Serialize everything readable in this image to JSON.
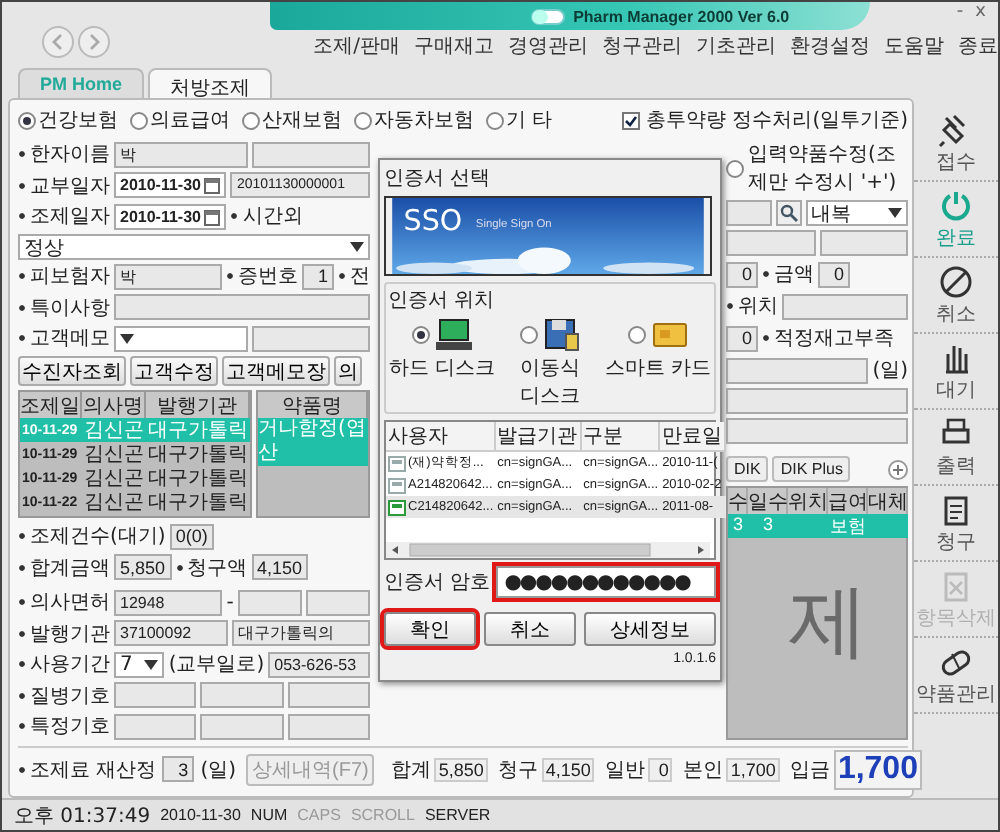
{
  "window": {
    "title": "Pharm Manager 2000 Ver 6.0",
    "controls": [
      "-",
      "x"
    ]
  },
  "menu": [
    "조제/판매",
    "구매재고",
    "경영관리",
    "청구관리",
    "기초관리",
    "환경설정",
    "도움말",
    "종료"
  ],
  "tabs": [
    {
      "label": "PM Home",
      "selected": false
    },
    {
      "label": "처방조제",
      "selected": true
    }
  ],
  "insurance_types": [
    {
      "label": "건강보험",
      "selected": true
    },
    {
      "label": "의료급여",
      "selected": false
    },
    {
      "label": "산재보험",
      "selected": false
    },
    {
      "label": "자동차보험",
      "selected": false
    },
    {
      "label": "기 타",
      "selected": false
    }
  ],
  "rounding_option": {
    "label": "총투약량 정수처리(일투기준)",
    "checked": true
  },
  "patient_form": [
    [
      {
        "kind": "label",
        "text": "한자이름"
      },
      {
        "kind": "field",
        "text": "박"
      },
      {
        "kind": "field"
      }
    ],
    [
      {
        "kind": "label",
        "text": "교부일자"
      },
      {
        "kind": "date",
        "text": "2010-11-30"
      },
      {
        "kind": "field",
        "text": "20101130000001"
      }
    ],
    [
      {
        "kind": "label",
        "text": "조제일자"
      },
      {
        "kind": "date",
        "text": "2010-11-30"
      },
      {
        "kind": "label",
        "text": "시간외"
      },
      {
        "kind": "select",
        "text": "정상"
      }
    ],
    [
      {
        "kind": "label",
        "text": "피보험자"
      },
      {
        "kind": "field",
        "text": "박"
      },
      {
        "kind": "label",
        "text": "증번호"
      },
      {
        "kind": "num",
        "text": "1"
      },
      {
        "kind": "label",
        "text": "전"
      }
    ],
    [
      {
        "kind": "label",
        "text": "특이사항"
      },
      {
        "kind": "field"
      }
    ],
    [
      {
        "kind": "label",
        "text": "고객메모"
      },
      {
        "kind": "select"
      },
      {
        "kind": "field"
      }
    ]
  ],
  "patient_buttons": [
    "수진자조회",
    "고객수정",
    "고객메모장",
    "의"
  ],
  "history": {
    "columns": [
      "조제일",
      "의사명",
      "발행기관"
    ],
    "rows": [
      {
        "cells": [
          "10-11-29",
          "김신곤",
          "대구가톨릭"
        ],
        "selected": true
      },
      {
        "cells": [
          "10-11-29",
          "김신곤",
          "대구가톨릭"
        ],
        "selected": false
      },
      {
        "cells": [
          "10-11-29",
          "김신곤",
          "대구가톨릭"
        ],
        "selected": false
      },
      {
        "cells": [
          "10-11-22",
          "김신곤",
          "대구가톨릭"
        ],
        "selected": false
      }
    ]
  },
  "drug_names": {
    "column": "약품명",
    "rows": [
      {
        "name": "거나함정(엽산",
        "selected": true
      }
    ]
  },
  "summary_form": [
    [
      {
        "kind": "label",
        "text": "조제건수(대기)"
      },
      {
        "kind": "num",
        "text": "0(0)"
      }
    ],
    [
      {
        "kind": "label",
        "text": "합계금액"
      },
      {
        "kind": "num",
        "text": "5,850"
      },
      {
        "kind": "label",
        "text": "청구액"
      },
      {
        "kind": "num",
        "text": "4,150"
      }
    ]
  ],
  "prescriber_form": [
    [
      {
        "kind": "label",
        "text": "의사면허"
      },
      {
        "kind": "field",
        "text": "12948"
      },
      {
        "kind": "note",
        "text": "-"
      },
      {
        "kind": "field"
      },
      {
        "kind": "field"
      }
    ],
    [
      {
        "kind": "label",
        "text": "발행기관"
      },
      {
        "kind": "field",
        "text": "37100092"
      },
      {
        "kind": "field",
        "text": "대구가톨릭의"
      }
    ],
    [
      {
        "kind": "label",
        "text": "사용기간"
      },
      {
        "kind": "select",
        "text": "7"
      },
      {
        "kind": "note",
        "text": "(교부일로)"
      },
      {
        "kind": "field",
        "text": "053-626-53"
      }
    ],
    [
      {
        "kind": "label",
        "text": "질병기호"
      },
      {
        "kind": "field"
      },
      {
        "kind": "field"
      },
      {
        "kind": "field"
      }
    ],
    [
      {
        "kind": "label",
        "text": "특정기호"
      },
      {
        "kind": "field"
      },
      {
        "kind": "field"
      },
      {
        "kind": "field"
      }
    ]
  ],
  "drug_entry": {
    "mode": {
      "label": "입력약품수정(조제만 수정시 '+')",
      "selected": false
    },
    "form": [
      [
        {
          "kind": "field"
        },
        {
          "kind": "search"
        },
        {
          "kind": "select",
          "text": "내복"
        }
      ],
      [
        {
          "kind": "field"
        },
        {
          "kind": "field"
        }
      ],
      [
        {
          "kind": "num",
          "text": "0"
        },
        {
          "kind": "label",
          "text": "금액"
        },
        {
          "kind": "num",
          "text": "0"
        }
      ],
      [
        {
          "kind": "label",
          "text": "위치"
        },
        {
          "kind": "field"
        }
      ],
      [
        {
          "kind": "num",
          "text": "0"
        },
        {
          "kind": "label",
          "text": "적정재고부족"
        }
      ],
      [
        {
          "kind": "field"
        },
        {
          "kind": "note",
          "text": "(일)"
        }
      ],
      [
        {
          "kind": "field"
        }
      ],
      [
        {
          "kind": "field"
        }
      ]
    ]
  },
  "drug_tabs": [
    {
      "label": "DIK",
      "selected": false
    },
    {
      "label": "DIK Plus",
      "selected": false
    }
  ],
  "drug_table": {
    "columns": [
      "수",
      "일수",
      "위치",
      "급여",
      "대체"
    ],
    "rows": [
      {
        "cells": [
          "3",
          "3",
          null,
          "보험",
          null
        ],
        "selected": true
      }
    ],
    "background_text": "제"
  },
  "recalc": {
    "label": "조제료 재산정",
    "value": "3",
    "unit": "(일)",
    "button": "상세내역(F7)",
    "button_disabled": true
  },
  "totals": [
    {
      "label": "합계",
      "value": "5,850",
      "kind": "normal"
    },
    {
      "label": "청구",
      "value": "4,150",
      "kind": "normal"
    },
    {
      "label": "일반",
      "value": "0",
      "kind": "normal"
    },
    {
      "label": "본인",
      "value": "1,700",
      "kind": "normal"
    },
    {
      "label": "입금",
      "value": "1,700",
      "kind": "grand"
    }
  ],
  "sidebar": [
    {
      "label": "접수",
      "kind": "plug",
      "active": false,
      "disabled": false
    },
    {
      "label": "완료",
      "kind": "power",
      "active": true,
      "disabled": false
    },
    {
      "label": "취소",
      "kind": "cancel",
      "active": false,
      "disabled": false
    },
    {
      "label": "대기",
      "kind": "hand",
      "active": false,
      "disabled": false
    },
    {
      "label": "출력",
      "kind": "print",
      "active": false,
      "disabled": false
    },
    {
      "label": "청구",
      "kind": "clipboard",
      "active": false,
      "disabled": false
    },
    {
      "label": "항목삭제",
      "kind": "delete",
      "active": false,
      "disabled": true
    },
    {
      "label": "약품관리",
      "kind": "pill",
      "active": false,
      "disabled": false
    }
  ],
  "certificate_dialog": {
    "title": "인증서 선택",
    "banner": {
      "logo": "SSO",
      "subtitle": "Single Sign On"
    },
    "location_label": "인증서 위치",
    "locations": [
      {
        "label": "하드 디스크",
        "kind": "hdd",
        "selected": true
      },
      {
        "label": "이동식 디스크",
        "kind": "removable",
        "selected": false
      },
      {
        "label": "스마트 카드",
        "kind": "smartcard",
        "selected": false
      }
    ],
    "columns": [
      "사용자",
      "발급기관",
      "구분",
      "만료일"
    ],
    "rows": [
      {
        "cells": [
          "(재)약학정...",
          "cn=signGA...",
          "cn=signGA...",
          "2010-11-("
        ],
        "kind": "plain",
        "selected": false
      },
      {
        "cells": [
          "A214820642...",
          "cn=signGA...",
          "cn=signGA...",
          "2010-02-2"
        ],
        "kind": "plain",
        "selected": false
      },
      {
        "cells": [
          "C214820642...",
          "cn=signGA...",
          "cn=signGA...",
          "2011-08-"
        ],
        "kind": "valid",
        "selected": true
      }
    ],
    "password": {
      "label": "인증서 암호",
      "value": "●●●●●●●●●●●●",
      "highlighted": true
    },
    "buttons": [
      {
        "label": "확인",
        "highlighted": true
      },
      {
        "label": "취소",
        "highlighted": false
      },
      {
        "label": "상세정보",
        "highlighted": false
      }
    ],
    "version": "1.0.1.6"
  },
  "status_bar": {
    "time": "오후 01:37:49",
    "date": "2010-11-30",
    "indicators": [
      {
        "label": "NUM",
        "on": true
      },
      {
        "label": "CAPS",
        "on": false
      },
      {
        "label": "SCROLL",
        "on": false
      },
      {
        "label": "SERVER",
        "on": true
      }
    ]
  }
}
